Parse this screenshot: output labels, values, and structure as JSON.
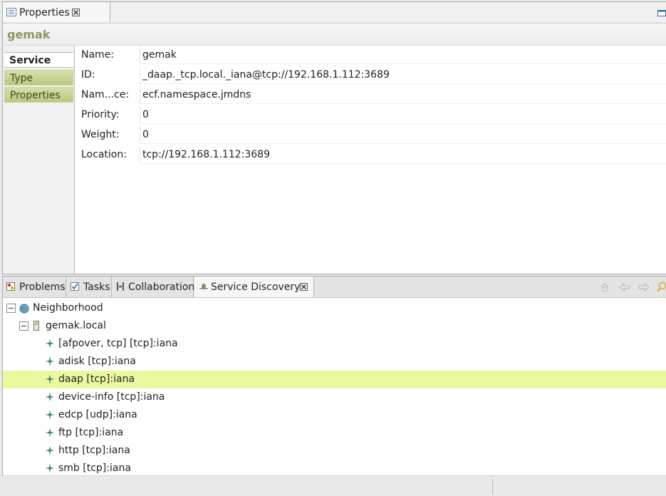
{
  "properties_view": {
    "tab_label": "Properties",
    "title": "gemak",
    "side_tabs": [
      "Service",
      "Type",
      "Properties"
    ],
    "fields": [
      {
        "label": "Name:",
        "value": "gemak"
      },
      {
        "label": "ID:",
        "value": "_daap._tcp.local._iana@tcp://192.168.1.112:3689"
      },
      {
        "label": "Nam...ce:",
        "value": "ecf.namespace.jmdns"
      },
      {
        "label": "Priority:",
        "value": "0"
      },
      {
        "label": "Weight:",
        "value": "0"
      },
      {
        "label": "Location:",
        "value": "tcp://192.168.1.112:3689"
      }
    ]
  },
  "bottom_view": {
    "tabs": [
      "Problems",
      "Tasks",
      "Collaboration",
      "Service Discovery"
    ],
    "active_tab": "Service Discovery",
    "tree": {
      "root": "Neighborhood",
      "host": "gemak.local",
      "services": [
        "[afpover, tcp] [tcp]:iana",
        "adisk [tcp]:iana",
        "daap [tcp]:iana",
        "device-info [tcp]:iana",
        "edcp [udp]:iana",
        "ftp [tcp]:iana",
        "http [tcp]:iana",
        "smb [tcp]:iana"
      ],
      "selected_service": "daap [tcp]:iana"
    }
  },
  "colors": {
    "title_green": "#8a9a5b",
    "selection_yellow": "#eaf9a0",
    "inactive_tab_green": "#c9d59a"
  }
}
